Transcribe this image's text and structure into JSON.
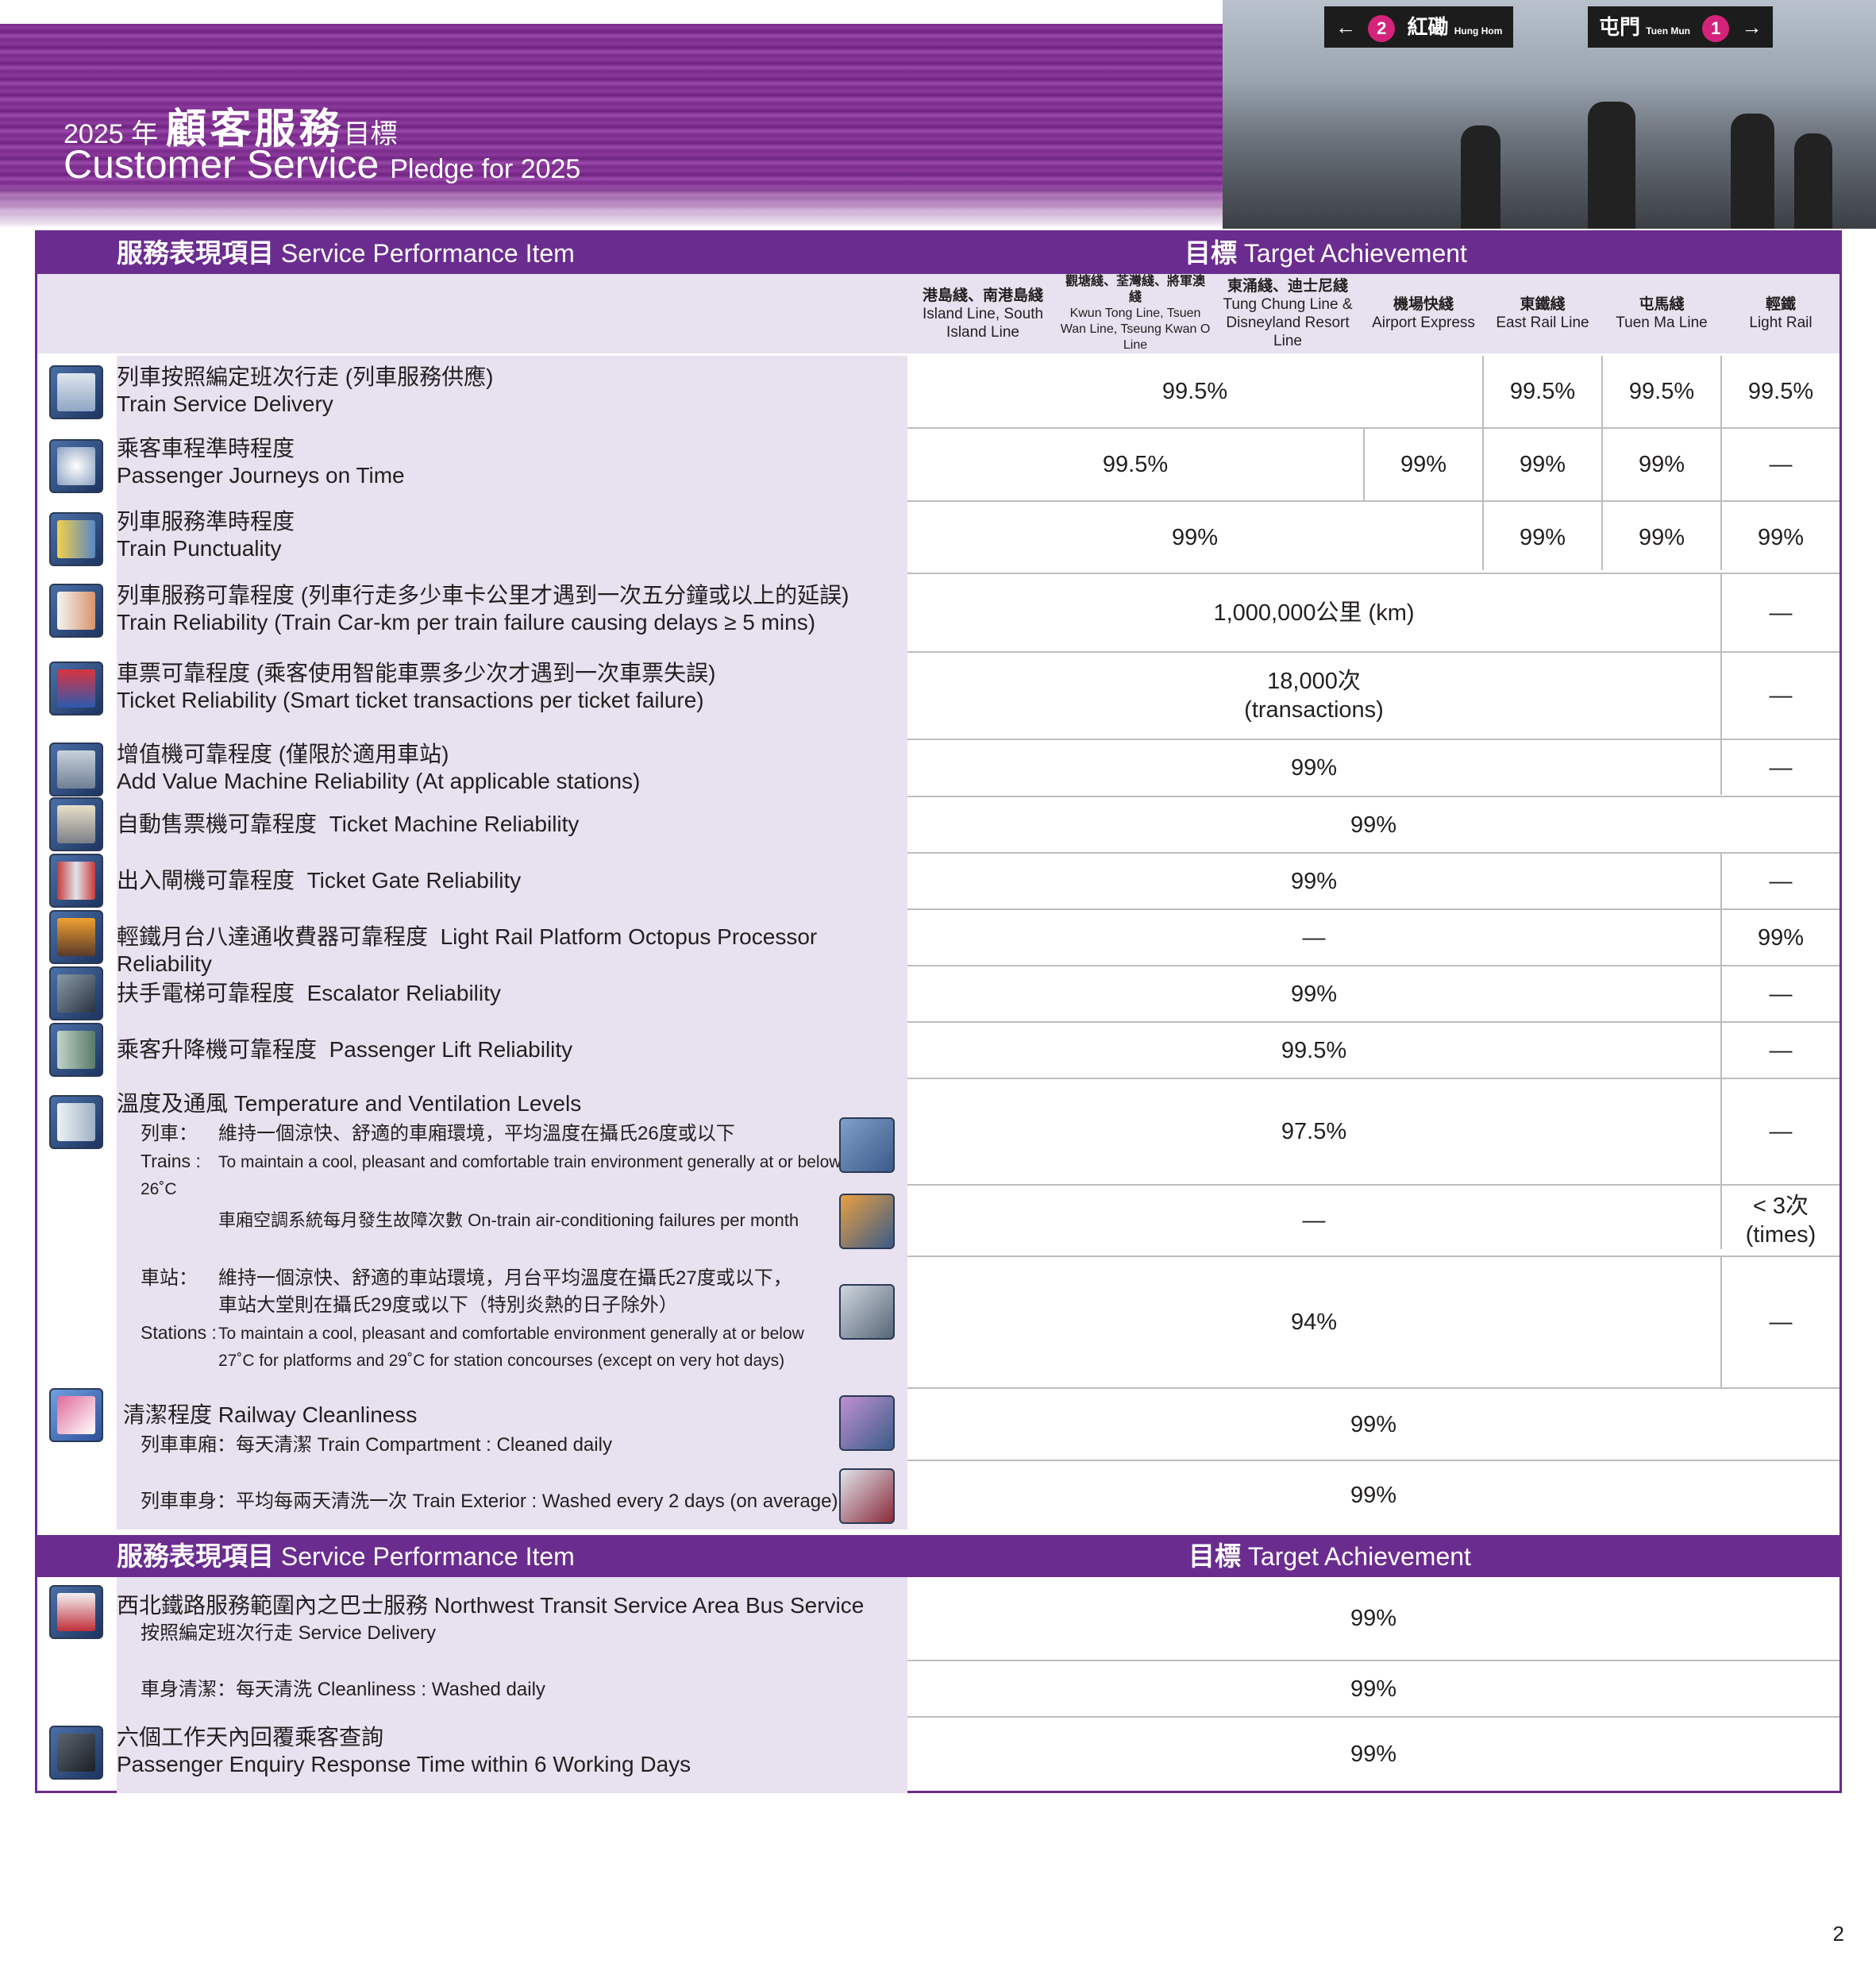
{
  "header": {
    "year": "2025 年",
    "title_zh_big": "顧客服務",
    "title_zh_tail": "目標",
    "title_en_big": "Customer Service",
    "title_en_small": "Pledge for 2025",
    "sign_left": "紅磡",
    "sign_left_en": "Hung Hom",
    "sign_left_num": "2",
    "sign_right": "屯門",
    "sign_right_en": "Tuen Mun",
    "sign_right_num": "1"
  },
  "table": {
    "item_header_zh": "服務表現項目",
    "item_header_en": "Service Performance Item",
    "target_header_zh": "目標",
    "target_header_en": "Target Achievement",
    "columns": [
      {
        "zh": "港島綫、南港島綫",
        "en": "Island Line, South Island Line"
      },
      {
        "zh": "觀塘綫、荃灣綫、將軍澳綫",
        "en": "Kwun Tong Line, Tsuen Wan Line, Tseung Kwan O Line"
      },
      {
        "zh": "東涌綫、迪士尼綫",
        "en": "Tung Chung Line & Disneyland Resort Line"
      },
      {
        "zh": "機場快綫",
        "en": "Airport Express"
      },
      {
        "zh": "東鐵綫",
        "en": "East Rail Line"
      },
      {
        "zh": "屯馬綫",
        "en": "Tuen Ma Line"
      },
      {
        "zh": "輕鐵",
        "en": "Light Rail"
      }
    ],
    "rows": {
      "train_service_delivery": {
        "zh": "列車按照編定班次行走 (列車服務供應)",
        "en": "Train Service Delivery",
        "v_main": "99.5%",
        "v_erl": "99.5%",
        "v_tml": "99.5%",
        "v_lr": "99.5%"
      },
      "passenger_journeys": {
        "zh": "乘客車程準時程度",
        "en": "Passenger Journeys on Time",
        "v_main": "99.5%",
        "v_ae": "99%",
        "v_erl": "99%",
        "v_tml": "99%",
        "v_lr": "—"
      },
      "train_punctuality": {
        "zh": "列車服務準時程度",
        "en": "Train Punctuality",
        "v_main": "99%",
        "v_erl": "99%",
        "v_tml": "99%",
        "v_lr": "99%"
      },
      "train_reliability": {
        "zh": "列車服務可靠程度 (列車行走多少車卡公里才遇到一次五分鐘或以上的延誤)",
        "en": "Train Reliability (Train Car-km per train failure causing delays ≥ 5 mins)",
        "v_main": "1,000,000公里 (km)",
        "v_lr": "—"
      },
      "ticket_reliability": {
        "zh": "車票可靠程度 (乘客使用智能車票多少次才遇到一次車票失誤)",
        "en": "Ticket Reliability  (Smart ticket transactions per ticket failure)",
        "v_main_1": "18,000次",
        "v_main_2": "(transactions)",
        "v_lr": "—"
      },
      "add_value": {
        "zh": "增值機可靠程度 (僅限於適用車站)",
        "en": "Add Value Machine Reliability (At applicable stations)",
        "v_main": "99%",
        "v_lr": "—"
      },
      "ticket_machine": {
        "zh": "自動售票機可靠程度",
        "en": "Ticket Machine Reliability",
        "v_main": "99%"
      },
      "ticket_gate": {
        "zh": "出入閘機可靠程度",
        "en": "Ticket Gate Reliability",
        "v_main": "99%",
        "v_lr": "—"
      },
      "lr_octopus": {
        "zh": "輕鐵月台八達通收費器可靠程度",
        "en": "Light Rail Platform Octopus Processor Reliability",
        "v_main": "—",
        "v_lr": "99%"
      },
      "escalator": {
        "zh": "扶手電梯可靠程度",
        "en": "Escalator Reliability",
        "v_main": "99%",
        "v_lr": "—"
      },
      "lift": {
        "zh": "乘客升降機可靠程度",
        "en": "Passenger Lift Reliability",
        "v_main": "99.5%",
        "v_lr": "—"
      },
      "temperature": {
        "zh": "溫度及通風",
        "en": "Temperature and Ventilation Levels",
        "trains_zh_label": "列車：",
        "trains_zh": "維持一個涼快、舒適的車廂環境，平均溫度在攝氏26度或以下",
        "trains_en_label": "Trains :",
        "trains_en": "To maintain a cool, pleasant and comfortable train environment generally at or below 26˚C",
        "trains_v_main": "97.5%",
        "trains_v_lr": "—",
        "ac": "車廂空調系統每月發生故障次數 On-train air-conditioning failures per month",
        "ac_v_main": "—",
        "ac_v_lr_1": "< 3次",
        "ac_v_lr_2": "(times)",
        "stations_zh_label": "車站：",
        "stations_zh_1": "維持一個涼快、舒適的車站環境，月台平均溫度在攝氏27度或以下，",
        "stations_zh_2": "車站大堂則在攝氏29度或以下（特別炎熱的日子除外）",
        "stations_en_label": "Stations :",
        "stations_en_1": "To maintain a cool, pleasant and comfortable environment generally at or below",
        "stations_en_2": "27˚C for platforms and 29˚C for station concourses (except on very hot days)",
        "stations_v_main": "94%",
        "stations_v_lr": "—"
      },
      "cleanliness": {
        "zh": "清潔程度",
        "en": "Railway Cleanliness",
        "comp": "列車車廂：每天清潔 Train Compartment : Cleaned daily",
        "comp_v": "99%",
        "ext": "列車車身：平均每兩天清洗一次 Train Exterior : Washed every 2 days (on average)",
        "ext_v": "99%"
      },
      "bus": {
        "zh": "西北鐵路服務範圍內之巴士服務",
        "en": "Northwest Transit Service Area Bus Service",
        "delivery": "按照編定班次行走 Service Delivery",
        "delivery_v": "99%",
        "clean": "車身清潔：每天清洗 Cleanliness : Washed daily",
        "clean_v": "99%"
      },
      "enquiry": {
        "zh": "六個工作天內回覆乘客查詢",
        "en": "Passenger Enquiry Response Time within 6 Working Days",
        "v": "99%"
      }
    }
  },
  "page_number": "2",
  "colors": {
    "purple": "#6b2c8f",
    "lavender": "#e8e1ef"
  }
}
